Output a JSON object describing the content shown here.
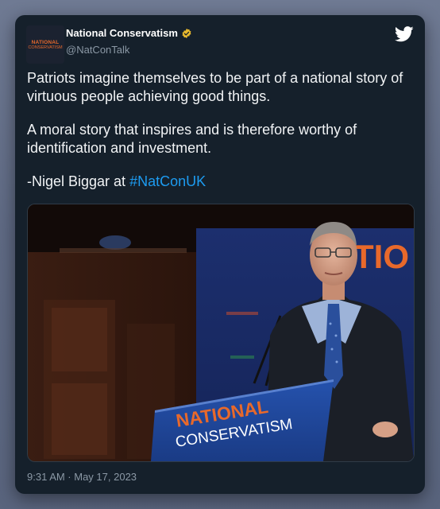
{
  "account": {
    "name": "National Conservatism",
    "handle": "@NatConTalk",
    "avatar_line1": "NATIONAL",
    "avatar_line2": "CONSERVATISM",
    "verified_icon": "verified-badge-icon",
    "verified_color": "#e8b92e"
  },
  "platform_icon": "twitter-bird-icon",
  "tweet": {
    "paragraph1": "Patriots imagine themselves to be part of a national story of virtuous people achieving good things.",
    "paragraph2": "A moral story that inspires and is therefore worthy of identification and investment.",
    "attribution_prefix": "-Nigel Biggar at ",
    "hashtag": "#NatConUK"
  },
  "media": {
    "backdrop_text": "TIO",
    "podium_line1": "NATIONAL",
    "podium_line2": "CONSERVATISM"
  },
  "timestamp": "9:31 AM · May 17, 2023",
  "colors": {
    "card_bg": "#15202b",
    "link": "#1d9bf0",
    "brand_orange": "#e8692b",
    "podium_blue": "#1f4597"
  }
}
